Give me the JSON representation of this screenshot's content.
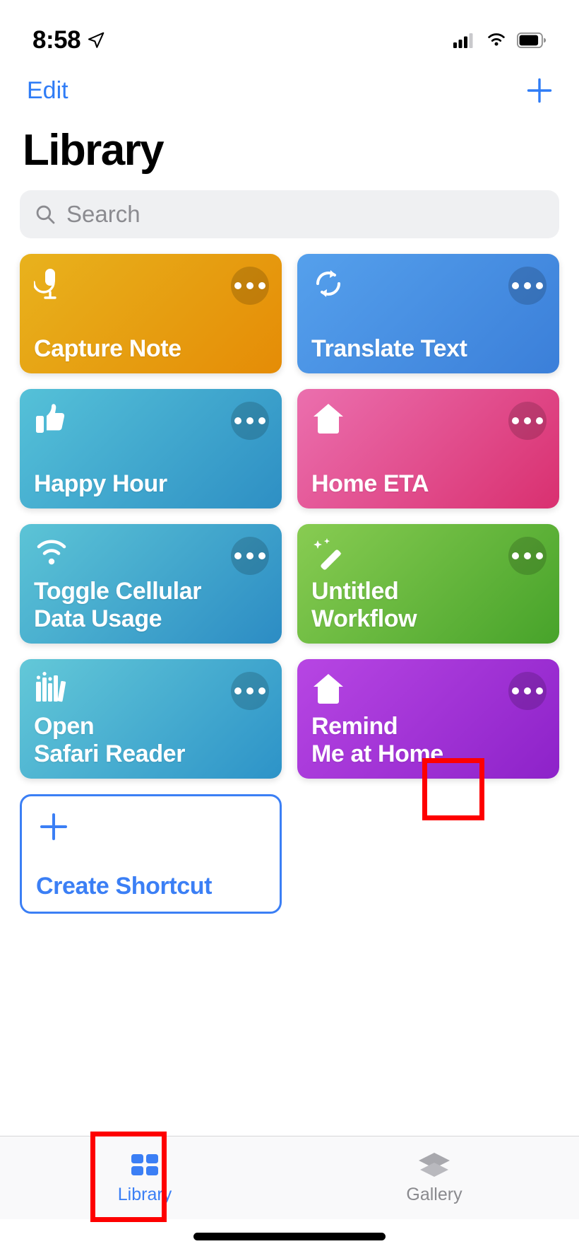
{
  "status_bar": {
    "time": "8:58",
    "location_icon": "location-arrow-icon",
    "cellular_icon": "cellular-signal-icon",
    "wifi_icon": "wifi-icon",
    "battery_icon": "battery-icon"
  },
  "nav": {
    "edit_label": "Edit",
    "add_icon": "plus-icon"
  },
  "header": {
    "title": "Library"
  },
  "search": {
    "placeholder": "Search",
    "icon": "search-icon"
  },
  "shortcuts": [
    {
      "label": "Capture Note",
      "icon": "microphone-icon",
      "color_start": "#e8b21d",
      "color_end": "#e58c06",
      "menu_icon": "ellipsis-icon",
      "highlighted": false
    },
    {
      "label": "Translate Text",
      "icon": "translate-arrows-icon",
      "color_start": "#55a0ec",
      "color_end": "#3b7fd9",
      "menu_icon": "ellipsis-icon",
      "highlighted": false
    },
    {
      "label": "Happy Hour",
      "icon": "thumbs-up-icon",
      "color_start": "#55c1d8",
      "color_end": "#2e8fc4",
      "menu_icon": "ellipsis-icon",
      "highlighted": false
    },
    {
      "label": "Home ETA",
      "icon": "house-icon",
      "color_start": "#eb6fae",
      "color_end": "#d93070",
      "menu_icon": "ellipsis-icon",
      "highlighted": false
    },
    {
      "label": "Toggle Cellular\nData Usage",
      "icon": "wifi-icon",
      "color_start": "#5cc4d6",
      "color_end": "#2c8cc4",
      "menu_icon": "ellipsis-icon",
      "highlighted": false
    },
    {
      "label": "Untitled\nWorkflow",
      "icon": "magic-wand-icon",
      "color_start": "#88cc52",
      "color_end": "#47a32a",
      "menu_icon": "ellipsis-icon",
      "highlighted": false
    },
    {
      "label": "Open\nSafari Reader",
      "icon": "books-icon",
      "color_start": "#63c8d8",
      "color_end": "#2d93c8",
      "menu_icon": "ellipsis-icon",
      "highlighted": false
    },
    {
      "label": "Remind\nMe at Home",
      "icon": "house-icon",
      "color_start": "#b746e3",
      "color_end": "#8d22c9",
      "menu_icon": "ellipsis-icon",
      "highlighted": true
    }
  ],
  "create_shortcut": {
    "label": "Create Shortcut",
    "icon": "plus-icon",
    "accent": "#3b7ff5"
  },
  "tab_bar": {
    "items": [
      {
        "label": "Library",
        "icon": "grid-squares-icon",
        "active": true
      },
      {
        "label": "Gallery",
        "icon": "layers-icon",
        "active": false
      }
    ]
  },
  "highlights": {
    "color": "#fe0000",
    "targets": [
      "remind-me-at-home-ellipsis-button",
      "tab-library"
    ]
  }
}
